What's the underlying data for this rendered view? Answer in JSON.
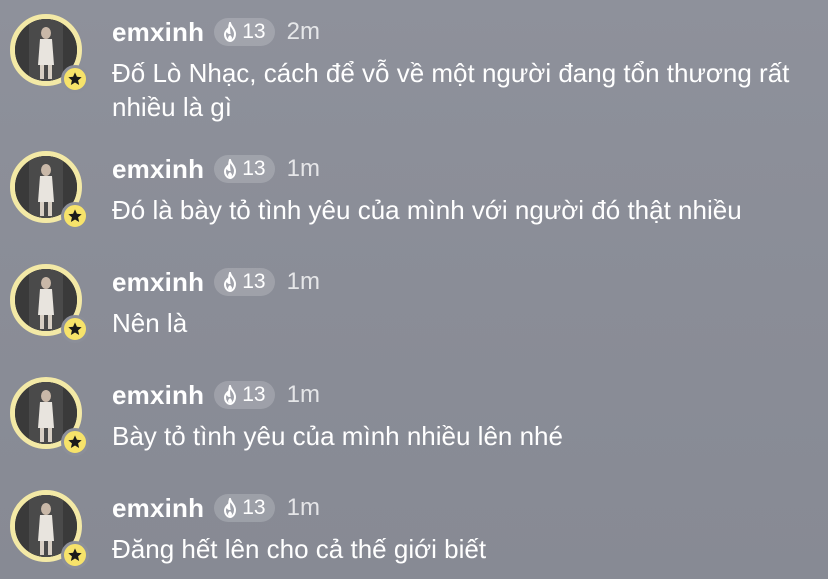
{
  "messages": [
    {
      "username": "emxinh",
      "streak": "13",
      "time": "2m",
      "text": "Đố Lò Nhạc, cách để vỗ về một người đang tổn thương rất nhiều là gì"
    },
    {
      "username": "emxinh",
      "streak": "13",
      "time": "1m",
      "text": "Đó là bày tỏ tình yêu của mình với người đó thật nhiều"
    },
    {
      "username": "emxinh",
      "streak": "13",
      "time": "1m",
      "text": "Nên là"
    },
    {
      "username": "emxinh",
      "streak": "13",
      "time": "1m",
      "text": "Bày tỏ tình yêu của mình nhiều lên nhé"
    },
    {
      "username": "emxinh",
      "streak": "13",
      "time": "1m",
      "text": "Đăng hết lên cho cả thế giới biết"
    }
  ],
  "icons": {
    "streak": "flame-icon",
    "badge": "star-icon"
  },
  "colors": {
    "background": "#8c8f99",
    "avatar_ring": "#f3e9a6",
    "star_badge": "#f7e36a",
    "text": "#ffffff"
  }
}
